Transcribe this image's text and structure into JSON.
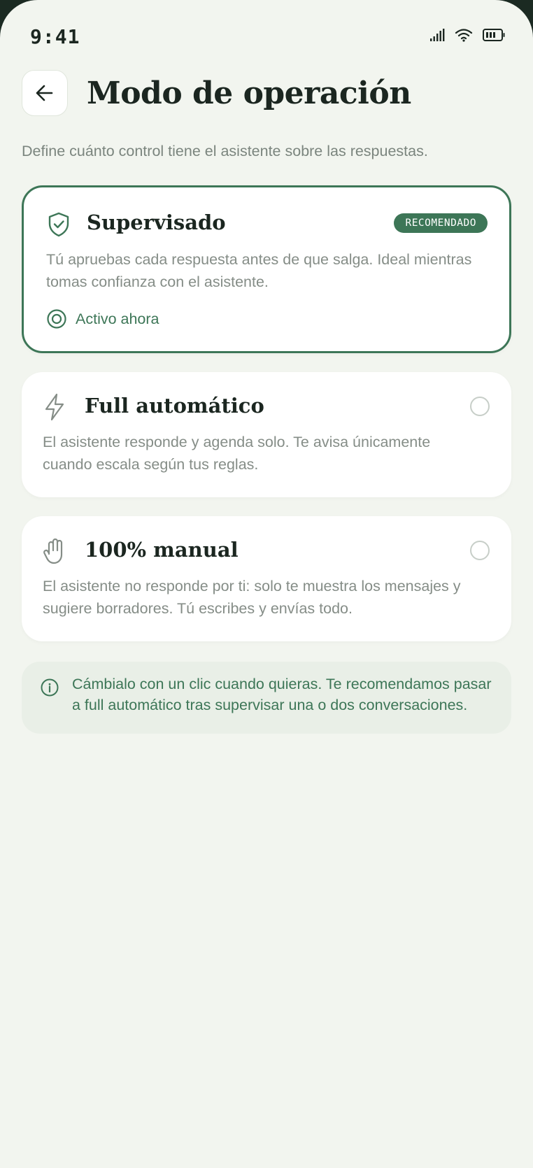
{
  "status_bar": {
    "time": "9:41",
    "icons": [
      "cellular-signal-icon",
      "wifi-icon",
      "battery-icon"
    ]
  },
  "header": {
    "back_icon": "arrow-left-icon",
    "title": "Modo de operación",
    "subtitle": "Define cuánto control tiene el asistente sobre las respuestas."
  },
  "options": [
    {
      "icon": "shield-check-icon",
      "title": "Supervisado",
      "badge": "RECOMENDADO",
      "description": "Tú apruebas cada respuesta antes de que salga. Ideal mientras tomas confianza con el asistente.",
      "status": "Activo ahora",
      "selected": true
    },
    {
      "icon": "lightning-icon",
      "title": "Full automático",
      "description": "El asistente responde y agenda solo. Te avisa únicamente cuando escala según tus reglas.",
      "selected": false
    },
    {
      "icon": "hand-icon",
      "title": "100% manual",
      "description": "El asistente no responde por ti: solo te muestra los mensajes y sugiere borradores. Tú escribes y envías todo.",
      "selected": false
    }
  ],
  "info": {
    "icon": "info-icon",
    "text": "Cámbialo con un clic cuando quieras. Te recomendamos pasar a full automático tras supervisar una o dos conversaciones."
  },
  "colors": {
    "accent": "#3d7657",
    "background": "#f2f5ef",
    "card": "#ffffff",
    "title_text": "#1b2620",
    "muted_text": "#858d87",
    "info_background": "#e9efe7",
    "radio_border": "#c7cec8"
  }
}
